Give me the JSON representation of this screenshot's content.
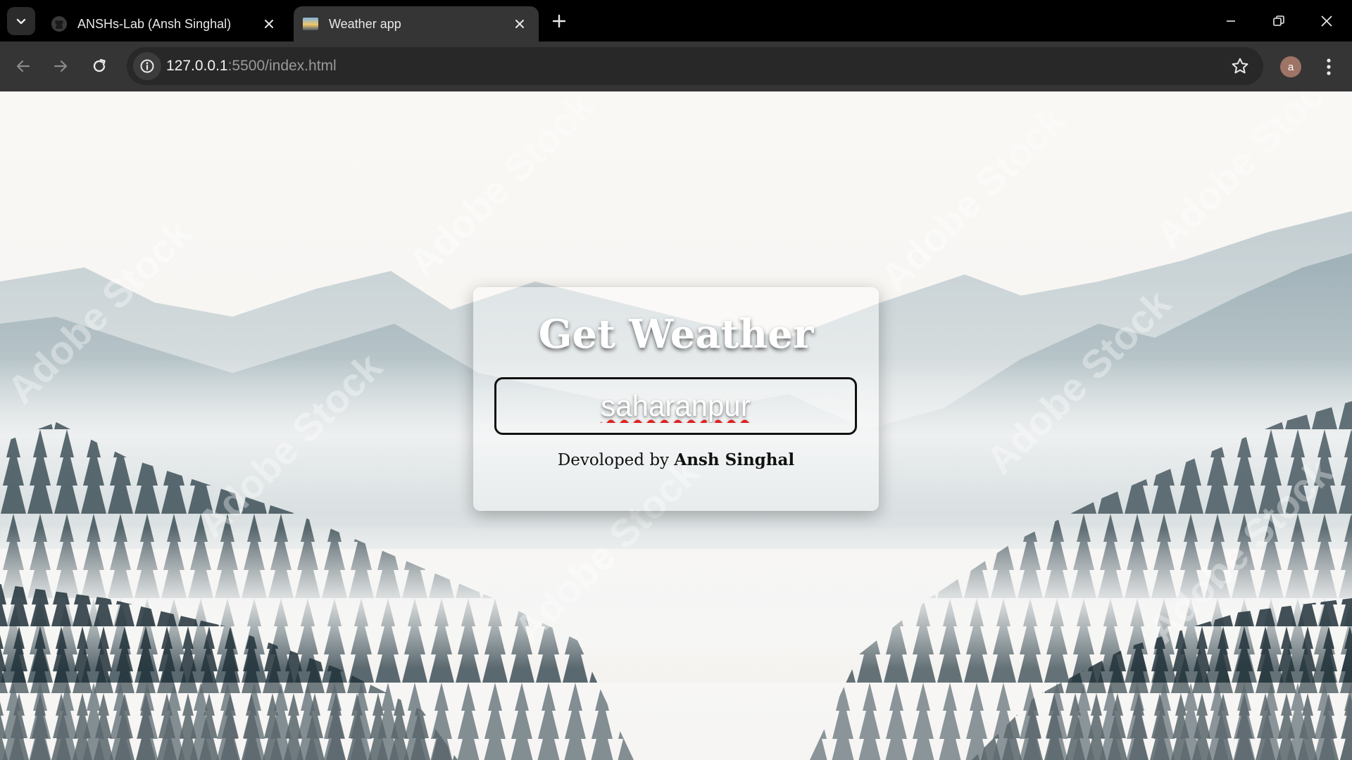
{
  "browser": {
    "tabs": [
      {
        "title": "ANSHs-Lab (Ansh Singhal)",
        "favicon": "github-icon",
        "active": false
      },
      {
        "title": "Weather app",
        "favicon": "weather-image-icon",
        "active": true
      }
    ],
    "url": {
      "host": "127.0.0.1",
      "path": ":5500/index.html"
    },
    "profile_initial": "a"
  },
  "page": {
    "heading": "Get Weather",
    "city_input_value": "saharanpur",
    "credit_prefix": "Devoloped by ",
    "credit_name": "Ansh Singhal",
    "background_watermark": "Adobe Stock"
  }
}
